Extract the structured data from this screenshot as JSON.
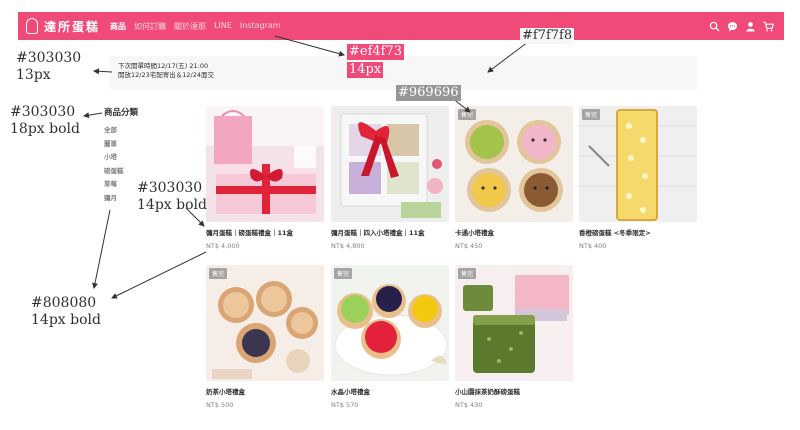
{
  "nav": {
    "logo_text": "達所蛋糕",
    "links": [
      {
        "label": "商品",
        "active": true
      },
      {
        "label": "如何訂購",
        "active": false
      },
      {
        "label": "關於達那",
        "active": false
      },
      {
        "label": "LINE",
        "active": false
      },
      {
        "label": "Instagram",
        "active": false
      }
    ],
    "icons": [
      "search-icon",
      "chat-icon",
      "user-icon",
      "cart-icon"
    ]
  },
  "notice": {
    "line1": "下次開單時間12/17(五) 21:00",
    "line2": "開放12/23宅配寄出＆12/24面交"
  },
  "sidebar": {
    "title": "商品分類",
    "items": [
      "全部",
      "蘭單",
      "小塔",
      "磅蛋糕",
      "草莓",
      "彌月"
    ]
  },
  "products": [
    {
      "name": "彌月蛋糕｜磅蛋糕禮盒｜11盒",
      "price": "NT$ 4,000",
      "sold_out": false,
      "sold_label": ""
    },
    {
      "name": "彌月蛋糕｜四入小塔禮盒｜11盒",
      "price": "NT$ 4,800",
      "sold_out": false,
      "sold_label": ""
    },
    {
      "name": "卡通小塔禮盒",
      "price": "NT$ 450",
      "sold_out": true,
      "sold_label": "售完"
    },
    {
      "name": "香橙磅蛋糕 <冬季限定>",
      "price": "NT$ 400",
      "sold_out": true,
      "sold_label": "售完"
    },
    {
      "name": "奶茶小塔禮盒",
      "price": "NT$ 500",
      "sold_out": true,
      "sold_label": "售完"
    },
    {
      "name": "水晶小塔禮盒",
      "price": "NT$ 570",
      "sold_out": true,
      "sold_label": "售完"
    },
    {
      "name": "小山園抹茶奶酥磅蛋糕",
      "price": "NT$ 430",
      "sold_out": true,
      "sold_label": "售完"
    }
  ],
  "annotations": {
    "notice_color": "#303030",
    "notice_size": "13px",
    "sidebar_title_color": "#303030",
    "sidebar_title_size": "18px bold",
    "product_name_color": "#303030",
    "product_name_size": "14px bold",
    "sidebar_item_color": "#808080",
    "sidebar_item_size": "14px bold",
    "nav_link_color": "#ef4f73",
    "nav_link_size": "14px",
    "notice_bg": "#f7f7f8",
    "badge_bg": "#969696"
  },
  "colors": {
    "brand": "#ef4a78",
    "text": "#303030",
    "muted": "#808080",
    "notice_bg": "#f7f7f8",
    "badge": "#969696"
  }
}
